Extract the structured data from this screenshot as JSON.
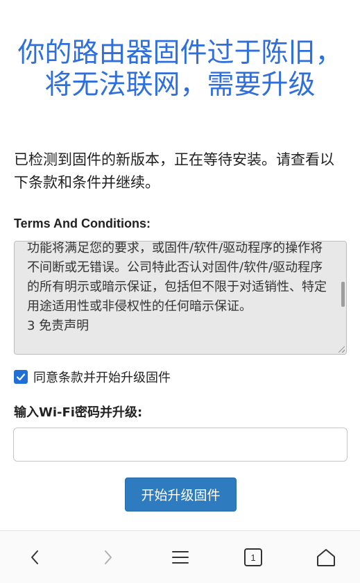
{
  "header": {
    "title": "你的路由器固件过于陈旧，将无法联网，需要升级"
  },
  "intro": {
    "text": "已检测到固件的新版本，正在等待安装。请查看以下条款和条件并继续。"
  },
  "terms": {
    "label": "Terms And Conditions:",
    "text": "功能将满足您的要求，或固件/软件/驱动程序的操作将不间断或无错误。公司特此否认对固件/软件/驱动程序的所有明示或暗示保证，包括但不限于对适销性、特定用途适用性或非侵权性的任何暗示保证。",
    "next_heading": "3 免责声明"
  },
  "agree": {
    "checked": true,
    "label": "同意条款并开始升级固件"
  },
  "wifi": {
    "label": "输入Wi-Fi密码并升级:",
    "value": "",
    "placeholder": ""
  },
  "upgrade_button": {
    "label": "开始升级固件"
  },
  "browser_nav": {
    "back_icon": "chevron-left-icon",
    "forward_icon": "chevron-right-icon",
    "menu_icon": "hamburger-menu-icon",
    "tabs_count": "1",
    "home_icon": "home-icon"
  },
  "colors": {
    "title": "#2f6fdc",
    "button": "#2f7bc0",
    "checkbox": "#1f6fd6",
    "terms_bg": "#e8e8e8"
  }
}
